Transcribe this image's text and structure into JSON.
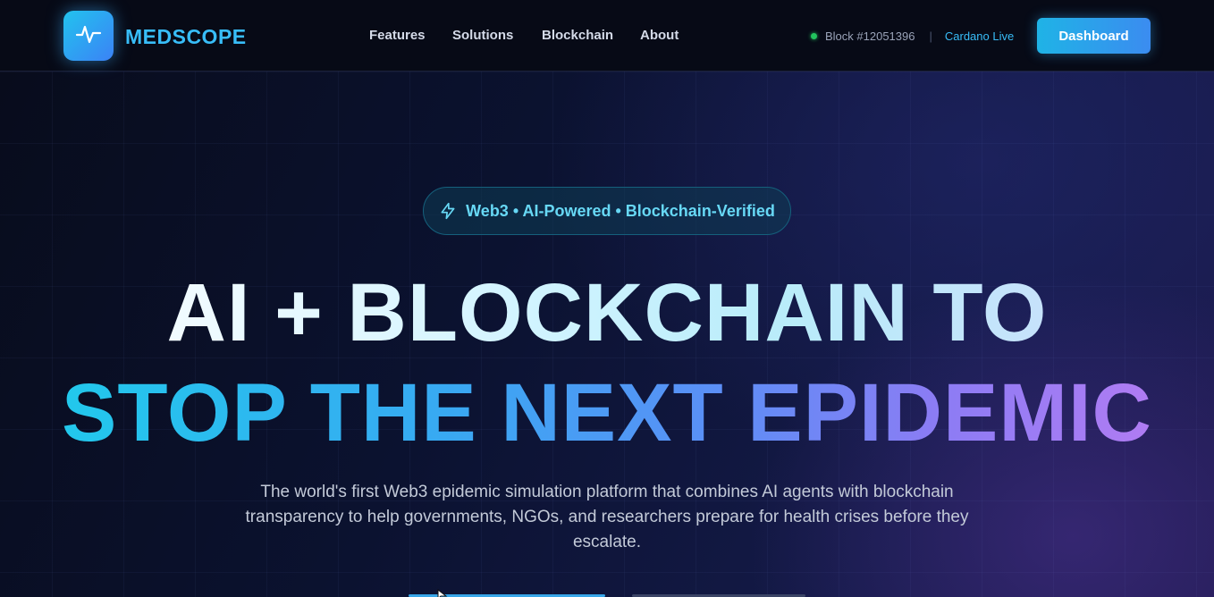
{
  "brand": {
    "name": "MEDSCOPE"
  },
  "nav": {
    "links": [
      "Features",
      "Solutions",
      "Blockchain",
      "About"
    ]
  },
  "status": {
    "block": "Block #12051396",
    "separator": "|",
    "network": "Cardano Live"
  },
  "header": {
    "dashboard_label": "Dashboard"
  },
  "hero": {
    "badge": "Web3 • AI-Powered • Blockchain-Verified",
    "headline_line1": "AI + BLOCKCHAIN TO",
    "headline_line2": "STOP THE NEXT EPIDEMIC",
    "subtitle": "The world's first Web3 epidemic simulation platform that combines AI agents with blockchain transparency to help governments, NGOs, and researchers prepare for health crises before they escalate."
  },
  "colors": {
    "accent": "#38bdf8",
    "status_dot": "#22c55e",
    "gradient_end": "#b07cf3"
  },
  "icons": [
    "pulse-icon",
    "lightning-icon",
    "status-dot-icon",
    "mouse-cursor-icon"
  ]
}
